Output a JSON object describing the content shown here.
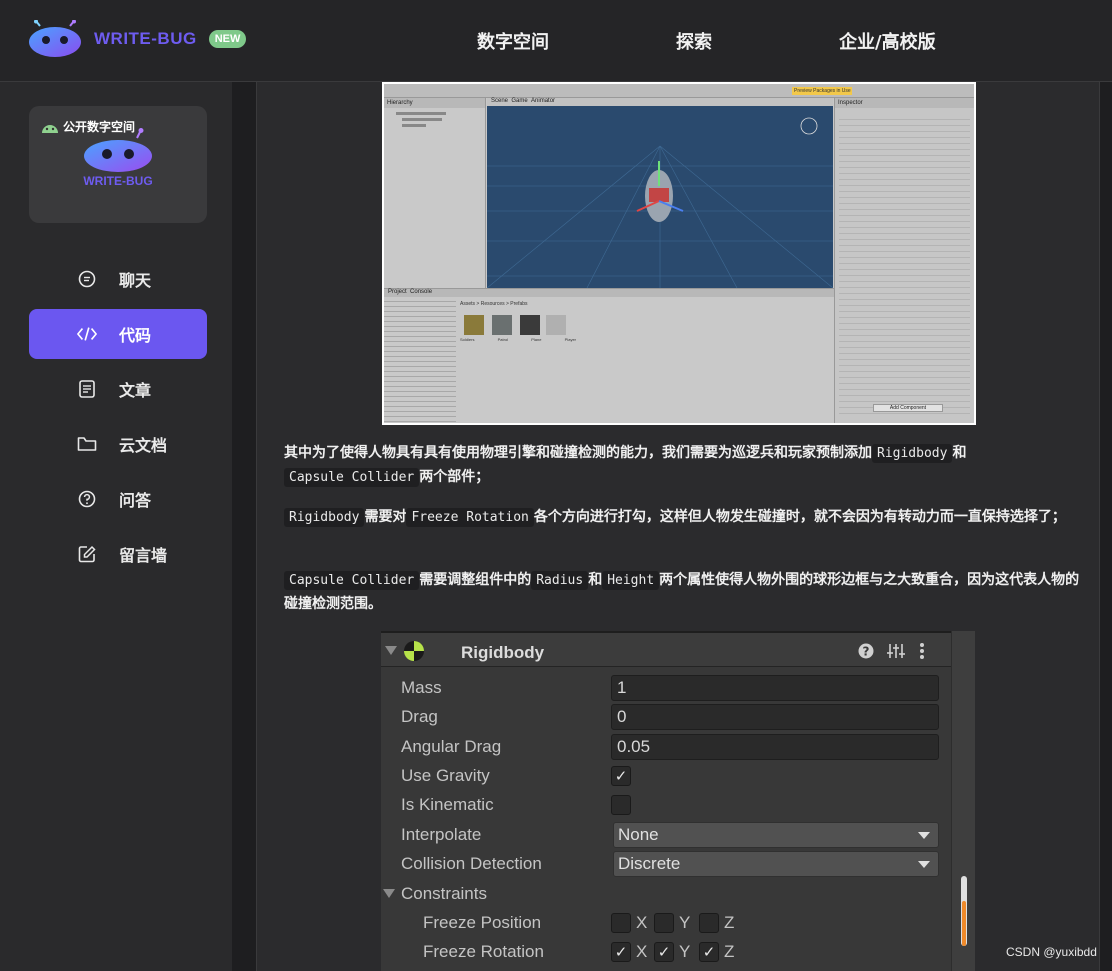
{
  "brand": {
    "name": "WRITE-BUG",
    "badge": "NEW"
  },
  "topnav": [
    {
      "label": "数字空间"
    },
    {
      "label": "探索"
    },
    {
      "label": "企业/高校版"
    }
  ],
  "sidebar": {
    "card": {
      "tag": "公开数字空间",
      "brand": "WRITE-BUG"
    },
    "items": [
      {
        "label": "聊天",
        "icon": "chat-icon"
      },
      {
        "label": "代码",
        "icon": "code-icon",
        "active": true
      },
      {
        "label": "文章",
        "icon": "article-icon"
      },
      {
        "label": "云文档",
        "icon": "folder-icon"
      },
      {
        "label": "问答",
        "icon": "question-icon"
      },
      {
        "label": "留言墙",
        "icon": "edit-icon"
      }
    ]
  },
  "article": {
    "p1": {
      "t1": "其中为了使得人物具有具有使用物理引擎和碰撞检测的能力，我们需要为巡逻兵和玩家预制添加",
      "c1": "Rigidbody",
      "t2": "和",
      "c2": "Capsule Collider",
      "t3": "两个部件；"
    },
    "p2": {
      "c1": "Rigidbody",
      "t1": "需要对",
      "c2": "Freeze Rotation",
      "t2": "各个方向进行打勾，这样但人物发生碰撞时，就不会因为有转动力而一直保持选择了；"
    },
    "p3": {
      "c1": "Capsule Collider",
      "t1": "需要调整组件中的",
      "c2": "Radius",
      "t2": "和",
      "c3": "Height",
      "t3": "两个属性使得人物外围的球形边框与之大致重合，因为这代表人物的碰撞检测范围。"
    }
  },
  "inspector": {
    "title": "Rigidbody",
    "fields": [
      {
        "label": "Mass",
        "value": "1"
      },
      {
        "label": "Drag",
        "value": "0"
      },
      {
        "label": "Angular Drag",
        "value": "0.05"
      }
    ],
    "use_gravity": {
      "label": "Use Gravity",
      "checked": true
    },
    "is_kinematic": {
      "label": "Is Kinematic",
      "checked": false
    },
    "interpolate": {
      "label": "Interpolate",
      "value": "None"
    },
    "collision": {
      "label": "Collision Detection",
      "value": "Discrete"
    },
    "constraints": {
      "label": "Constraints"
    },
    "freeze_position": {
      "label": "Freeze Position",
      "x": "X",
      "y": "Y",
      "z": "Z"
    },
    "freeze_rotation": {
      "label": "Freeze Rotation",
      "x": "X",
      "y": "Y",
      "z": "Z"
    }
  },
  "unity_shot": {
    "hierarchy": "Hierarchy",
    "scene": "Scene",
    "game": "Game",
    "animator": "Animator",
    "inspector": "Inspector",
    "project": "Project",
    "console": "Console",
    "assets_path": "Assets > Resources > Prefabs",
    "prefabs": [
      "Soldiers",
      "Patrol",
      "Plane",
      "Player"
    ],
    "add_component": "Add Component",
    "preview": "Preview Packages in Use"
  },
  "watermark": "CSDN @yuxibdd",
  "colors": {
    "accent": "#6b57f0",
    "badge": "#7fc98a",
    "unity_bg": "#2a4a6e"
  }
}
